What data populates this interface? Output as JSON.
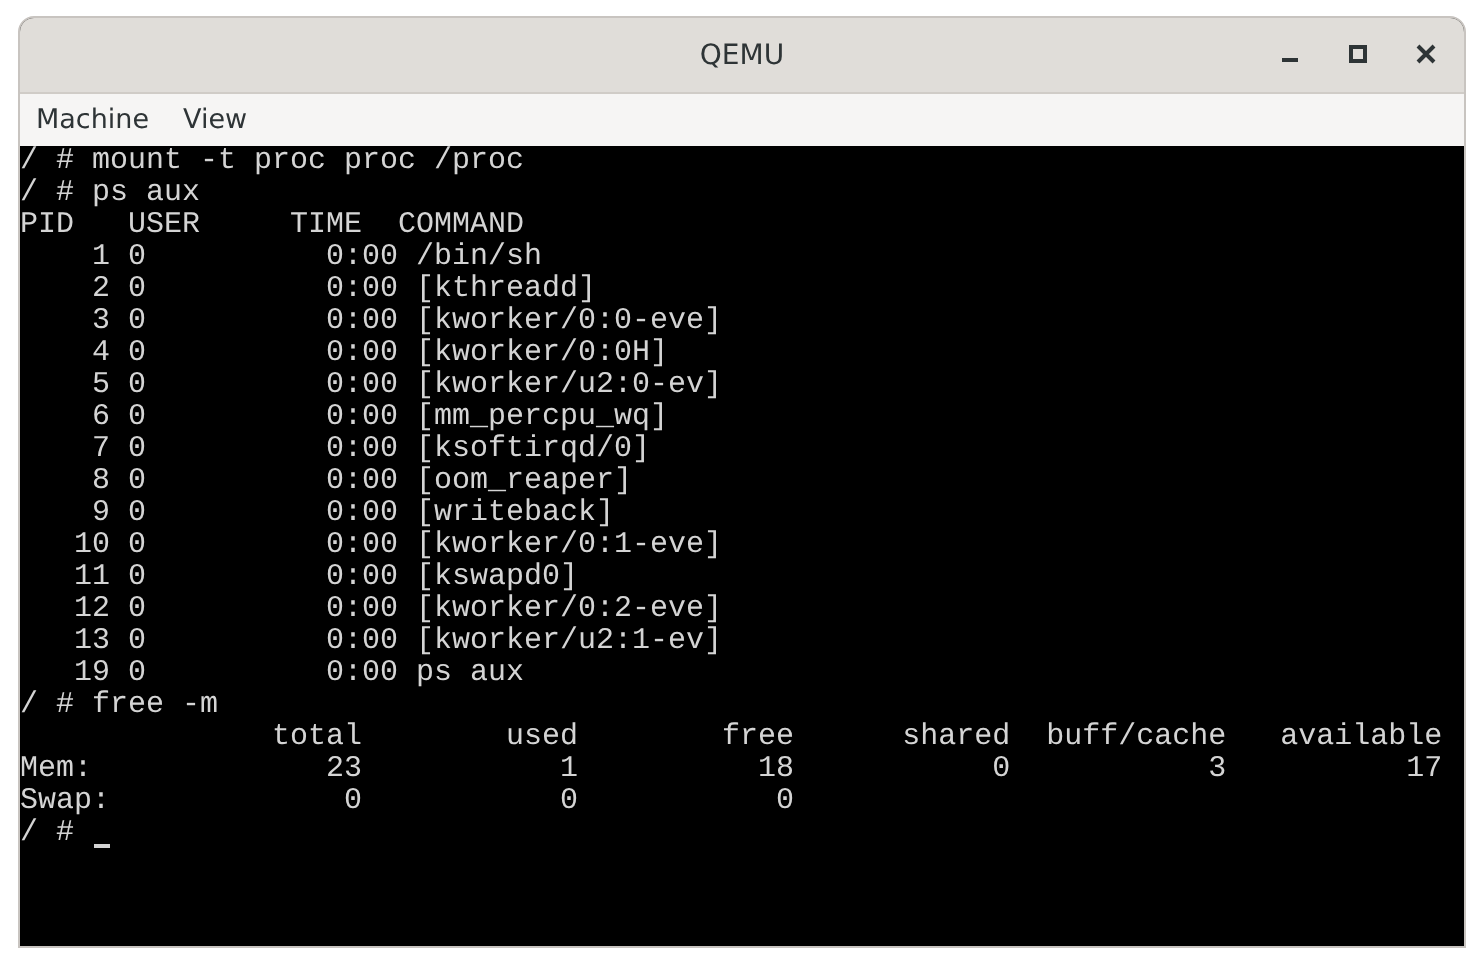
{
  "window": {
    "title": "QEMU"
  },
  "menu": [
    {
      "label": "Machine"
    },
    {
      "label": "View"
    }
  ],
  "terminal": {
    "lines": [
      "/ # mount -t proc proc /proc",
      "/ # ps aux",
      "PID   USER     TIME  COMMAND",
      "    1 0          0:00 /bin/sh",
      "    2 0          0:00 [kthreadd]",
      "    3 0          0:00 [kworker/0:0-eve]",
      "    4 0          0:00 [kworker/0:0H]",
      "    5 0          0:00 [kworker/u2:0-ev]",
      "    6 0          0:00 [mm_percpu_wq]",
      "    7 0          0:00 [ksoftirqd/0]",
      "    8 0          0:00 [oom_reaper]",
      "    9 0          0:00 [writeback]",
      "   10 0          0:00 [kworker/0:1-eve]",
      "   11 0          0:00 [kswapd0]",
      "   12 0          0:00 [kworker/0:2-eve]",
      "   13 0          0:00 [kworker/u2:1-ev]",
      "   19 0          0:00 ps aux",
      "/ # free -m",
      "              total        used        free      shared  buff/cache   available",
      "Mem:             23           1          18           0           3          17",
      "Swap:             0           0           0"
    ],
    "prompt": "/ #"
  }
}
